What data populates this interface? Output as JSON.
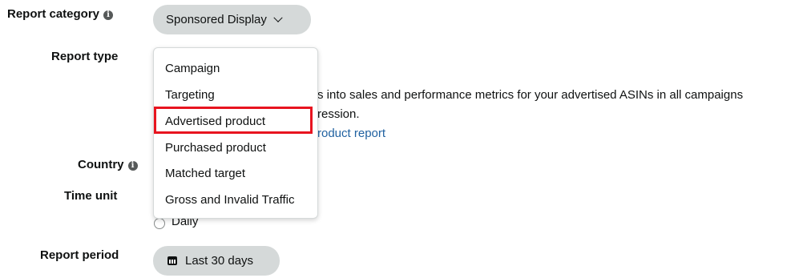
{
  "form": {
    "report_category": {
      "label": "Report category",
      "value": "Sponsored Display"
    },
    "report_type": {
      "label": "Report type",
      "description_line1": "s into sales and performance metrics for your advertised ASINs in all campaigns",
      "description_line2": "ression.",
      "link_text": "roduct report"
    },
    "country": {
      "label": "Country"
    },
    "time_unit": {
      "label": "Time unit",
      "option_daily": "Daily"
    },
    "report_period": {
      "label": "Report period",
      "value": "Last 30 days"
    }
  },
  "dropdown": {
    "options": [
      "Campaign",
      "Targeting",
      "Advertised product",
      "Purchased product",
      "Matched target",
      "Gross and Invalid Traffic"
    ],
    "highlighted": "Advertised product"
  },
  "icons": {
    "info": "info-icon",
    "chevron": "chevron-down-icon",
    "calendar": "calendar-icon"
  },
  "colors": {
    "pill_bg": "#d5d9d9",
    "link": "#2162a1",
    "highlight_border": "#e8141f"
  }
}
